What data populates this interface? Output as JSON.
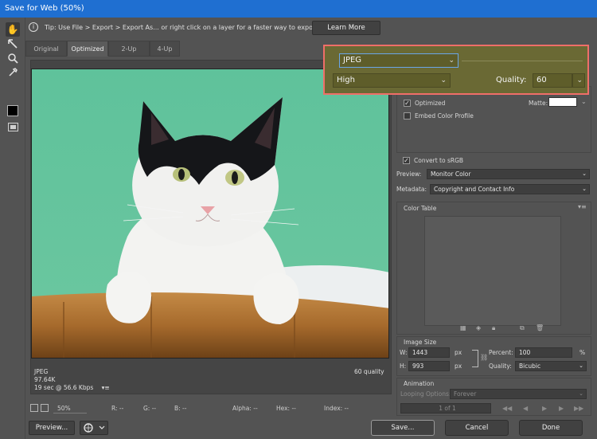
{
  "window": {
    "title": "Save for Web (50%)"
  },
  "tools": [
    {
      "name": "hand-tool-icon",
      "glyph": "✋"
    },
    {
      "name": "slice-select-tool-icon",
      "glyph": "↘"
    },
    {
      "name": "zoom-tool-icon",
      "glyph": "🔍"
    },
    {
      "name": "eyedropper-tool-icon",
      "glyph": "✎"
    }
  ],
  "tip": {
    "text": "Tip: Use File > Export > Export As...  or right click on a layer for a faster way to export assets",
    "button": "Learn More"
  },
  "tabs": [
    "Original",
    "Optimized",
    "2-Up",
    "4-Up"
  ],
  "image_info": {
    "format": "JPEG",
    "size": "97.64K",
    "download": "19 sec @ 56.6 Kbps",
    "menu_glyph": "▾≡",
    "quality": "60 quality"
  },
  "statusbar": {
    "zoom": "50%",
    "r": "R: --",
    "g": "G: --",
    "b": "B: --",
    "alpha": "Alpha: --",
    "hex": "Hex: --",
    "index": "Index: --"
  },
  "settings": {
    "format": "JPEG",
    "compression": "High",
    "quality_label": "Quality:",
    "quality_value": "60",
    "optimized_label": "Optimized",
    "embed_label": "Embed Color Profile",
    "matte_label": "Matte:",
    "convert_label": "Convert to sRGB",
    "preview_label": "Preview:",
    "preview_value": "Monitor Color",
    "metadata_label": "Metadata:",
    "metadata_value": "Copyright and Contact Info"
  },
  "color_table": {
    "title": "Color Table"
  },
  "image_size": {
    "title": "Image Size",
    "w_label": "W:",
    "w_value": "1443",
    "h_label": "H:",
    "h_value": "993",
    "unit": "px",
    "percent_label": "Percent:",
    "percent_value": "100",
    "percent_unit": "%",
    "quality_label": "Quality:",
    "quality_value": "Bicubic"
  },
  "animation": {
    "title": "Animation",
    "looping_label": "Looping Options:",
    "looping_value": "Forever",
    "frame_counter": "1 of 1"
  },
  "buttons": {
    "preview": "Preview...",
    "save": "Save...",
    "cancel": "Cancel",
    "done": "Done"
  },
  "colors": {
    "highlight_border": "#ef6e69",
    "highlight_fill": "#6a6934",
    "cat_background": "#66c29b"
  }
}
